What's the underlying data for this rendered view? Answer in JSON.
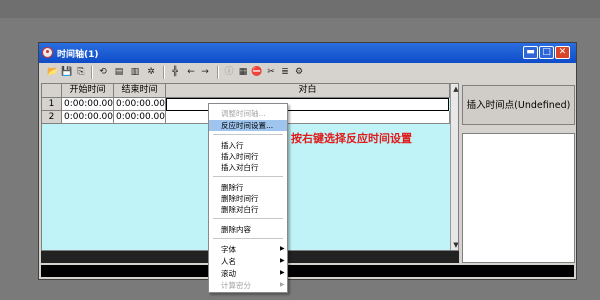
{
  "window": {
    "title": "时间轴(1)"
  },
  "title_buttons": {
    "minimize": "▬",
    "maximize": "□",
    "close": "✕"
  },
  "toolbar_icons": [
    "open-icon",
    "save-icon",
    "copy-icon",
    "refresh-icon",
    "chart-icon",
    "chart2-icon",
    "gear-icon",
    "grid-icon",
    "arrow-left-icon",
    "arrow-right-icon",
    "info-icon",
    "film-icon",
    "stop-icon",
    "cut-icon",
    "layers-icon",
    "settings-icon"
  ],
  "table": {
    "columns": [
      "开始时间",
      "结束时间",
      "对白"
    ],
    "rows": [
      {
        "num": "1",
        "start": "0:00:00.00",
        "end": "0:00:00.00",
        "text": ""
      },
      {
        "num": "2",
        "start": "0:00:00.00",
        "end": "0:00:00.00",
        "text": ""
      }
    ]
  },
  "side": {
    "insert_button": "插入时间点(Undefined)"
  },
  "hint": "按右键选择反应时间设置",
  "context_menu": {
    "items": [
      {
        "label": "调整时间轴...",
        "disabled": true
      },
      {
        "label": "反应时间设置...",
        "highlighted": true
      },
      {
        "label": "插入行"
      },
      {
        "label": "插入时间行"
      },
      {
        "label": "插入对白行"
      },
      {
        "label": "删除行"
      },
      {
        "label": "删除时间行"
      },
      {
        "label": "删除对白行"
      },
      {
        "label": "删除内容"
      },
      {
        "label": "字体",
        "submenu": true
      },
      {
        "label": "人名",
        "submenu": true
      },
      {
        "label": "滚动",
        "submenu": true
      },
      {
        "label": "计算密分",
        "submenu": true,
        "disabled": true
      }
    ]
  }
}
